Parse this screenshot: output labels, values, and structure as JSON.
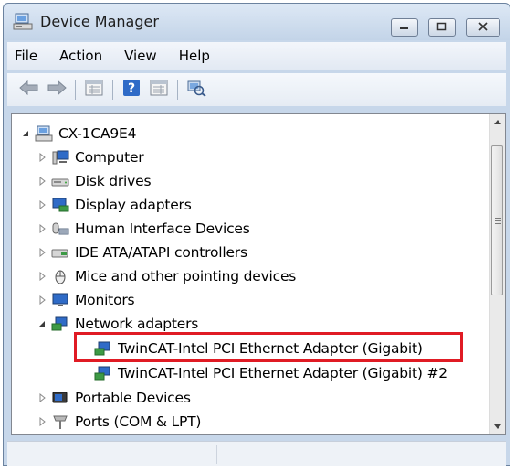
{
  "window": {
    "title": "Device Manager",
    "controls": [
      "minimize-icon",
      "maximize-icon",
      "close-icon"
    ]
  },
  "menubar": {
    "items": [
      "File",
      "Action",
      "View",
      "Help"
    ]
  },
  "toolbar": {
    "icons": [
      "back-arrow-icon",
      "forward-arrow-icon",
      "properties-grid-icon",
      "help-icon",
      "details-grid-icon",
      "scan-hardware-icon"
    ]
  },
  "tree": {
    "root": "CX-1CA9E4",
    "categories": [
      {
        "label": "Computer",
        "icon": "computer-icon",
        "expanded": false
      },
      {
        "label": "Disk drives",
        "icon": "disk-drive-icon",
        "expanded": false
      },
      {
        "label": "Display adapters",
        "icon": "display-adapter-icon",
        "expanded": false
      },
      {
        "label": "Human Interface Devices",
        "icon": "hid-icon",
        "expanded": false
      },
      {
        "label": "IDE ATA/ATAPI controllers",
        "icon": "ide-controller-icon",
        "expanded": false
      },
      {
        "label": "Mice and other pointing devices",
        "icon": "mouse-icon",
        "expanded": false
      },
      {
        "label": "Monitors",
        "icon": "monitor-icon",
        "expanded": false
      },
      {
        "label": "Network adapters",
        "icon": "network-adapter-icon",
        "expanded": true
      },
      {
        "label": "Portable Devices",
        "icon": "portable-device-icon",
        "expanded": false
      },
      {
        "label": "Ports (COM & LPT)",
        "icon": "port-icon",
        "expanded": false
      }
    ],
    "network_adapters": [
      {
        "label": "TwinCAT-Intel PCI Ethernet Adapter (Gigabit)",
        "highlighted": true
      },
      {
        "label": "TwinCAT-Intel PCI Ethernet Adapter (Gigabit) #2",
        "highlighted": false
      }
    ]
  },
  "colors": {
    "highlight_border": "#e01b24",
    "window_frame": "#c7d7ea"
  }
}
